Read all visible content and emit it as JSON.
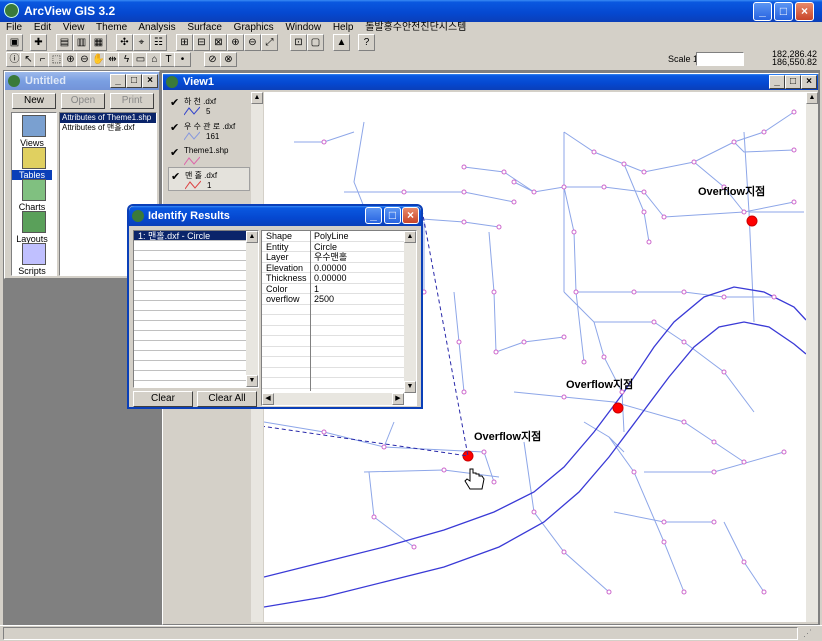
{
  "app": {
    "title": "ArcView GIS 3.2",
    "menu": [
      "File",
      "Edit",
      "View",
      "Theme",
      "Analysis",
      "Surface",
      "Graphics",
      "Window",
      "Help",
      "돌발홍수안전진단시스템"
    ],
    "scale_label": "Scale 1:",
    "scale_value": "",
    "coord_x": "182,286.42",
    "coord_y": "186,550.82"
  },
  "project": {
    "title": "Untitled",
    "buttons": [
      "New",
      "Open",
      "Print"
    ],
    "categories": [
      "Views",
      "Tables",
      "Charts",
      "Layouts",
      "Scripts"
    ],
    "items": [
      "Attributes of Theme1.shp",
      "Attributes of 맨홀.dxf"
    ]
  },
  "view": {
    "title": "View1",
    "themes": [
      {
        "name": "하 천 .dxf",
        "sub": "5",
        "color": "#3344cc"
      },
      {
        "name": "우 수 관 로 .dxf",
        "sub": "161",
        "color": "#8899dd"
      },
      {
        "name": "Theme1.shp",
        "sub": "",
        "color": "#dd66aa"
      },
      {
        "name": "맨 홀 .dxf",
        "sub": "1",
        "color": "#dd4444"
      }
    ],
    "annotations": [
      "Overflow지점",
      "Overflow지점",
      "Overflow지점"
    ]
  },
  "identify": {
    "title": "Identify Results",
    "selected": "1:  맨홀.dxf - Circle",
    "attributes": [
      {
        "key": "Shape",
        "value": "PolyLine"
      },
      {
        "key": "Entity",
        "value": "Circle"
      },
      {
        "key": "Layer",
        "value": "우수맨홀"
      },
      {
        "key": "Elevation",
        "value": "0.00000"
      },
      {
        "key": "Thickness",
        "value": "0.00000"
      },
      {
        "key": "Color",
        "value": "1"
      },
      {
        "key": "overflow",
        "value": "2500"
      }
    ],
    "clear_label": "Clear",
    "clear_all_label": "Clear All"
  },
  "colors": {
    "river": "#3a3ad6",
    "pipe": "#8da6e8",
    "manhole": "#cc66cc",
    "overflow": "#ff0000"
  }
}
